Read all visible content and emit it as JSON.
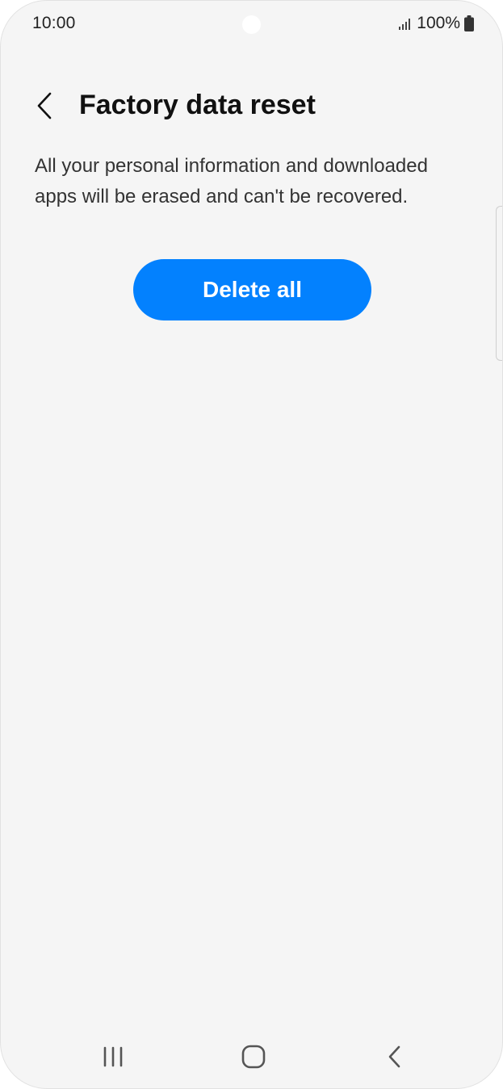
{
  "status_bar": {
    "time": "10:00",
    "battery_text": "100%",
    "icons": [
      "signal-icon",
      "battery-icon"
    ]
  },
  "header": {
    "title": "Factory data reset",
    "back_icon": "chevron-left-icon"
  },
  "content": {
    "description": "All your personal information and downloaded apps will be erased and can't be recovered.",
    "delete_button_label": "Delete all"
  },
  "nav_bar": {
    "icons": [
      "recent-apps-icon",
      "home-icon",
      "back-icon"
    ]
  },
  "colors": {
    "background": "#f5f5f5",
    "accent": "#0381fe",
    "text": "#111111"
  }
}
